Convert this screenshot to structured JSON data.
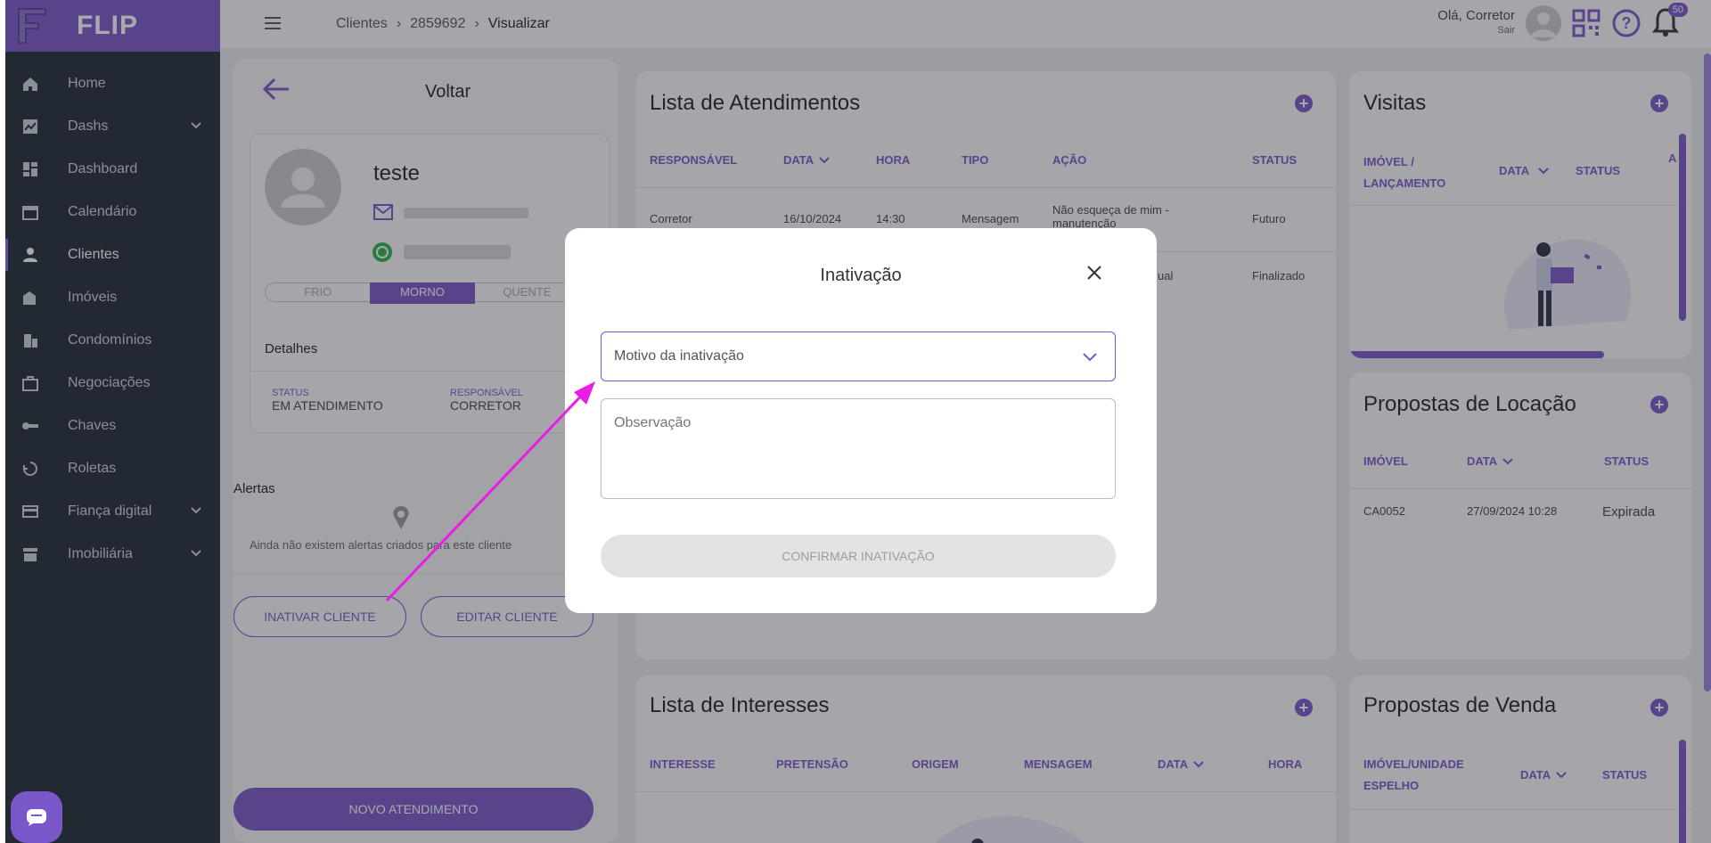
{
  "brand": {
    "name": "FLIP"
  },
  "sidebar": {
    "items": [
      {
        "label": "Home",
        "icon": "home-icon"
      },
      {
        "label": "Dashs",
        "icon": "chart-icon",
        "expandable": true
      },
      {
        "label": "Dashboard",
        "icon": "dashboard-icon"
      },
      {
        "label": "Calendário",
        "icon": "calendar-icon"
      },
      {
        "label": "Clientes",
        "icon": "person-icon",
        "active": true
      },
      {
        "label": "Imóveis",
        "icon": "building-icon"
      },
      {
        "label": "Condomínios",
        "icon": "condo-icon"
      },
      {
        "label": "Negociações",
        "icon": "briefcase-icon"
      },
      {
        "label": "Chaves",
        "icon": "key-icon"
      },
      {
        "label": "Roletas",
        "icon": "roulette-icon"
      },
      {
        "label": "Fiança digital",
        "icon": "card-icon",
        "expandable": true
      },
      {
        "label": "Imobiliária",
        "icon": "store-icon",
        "expandable": true
      }
    ]
  },
  "topbar": {
    "breadcrumb": [
      "Clientes",
      "2859692",
      "Visualizar"
    ],
    "greeting": "Olá, Corretor",
    "logout": "Sair",
    "notifications": "50"
  },
  "client": {
    "back": "Voltar",
    "name": "teste",
    "temps": [
      "FRIO",
      "MORNO",
      "QUENTE"
    ],
    "details_title": "Detalhes",
    "status_label": "STATUS",
    "status_value": "EM ATENDIMENTO",
    "resp_label": "RESPONSÁVEL",
    "resp_value": "CORRETOR",
    "alerts_title": "Alertas",
    "alerts_empty": "Ainda não existem alertas criados para este cliente",
    "inactivate": "INATIVAR CLIENTE",
    "edit": "EDITAR CLIENTE",
    "new_service": "NOVO ATENDIMENTO"
  },
  "atendimentos": {
    "title": "Lista de Atendimentos",
    "headers": [
      "RESPONSÁVEL",
      "DATA",
      "HORA",
      "TIPO",
      "AÇÃO",
      "STATUS"
    ],
    "rows": [
      [
        "Corretor",
        "16/10/2024",
        "14:30",
        "Mensagem",
        "Não esqueça de mim - manutenção",
        "Futuro"
      ],
      [
        "",
        "",
        "",
        "",
        "ual",
        "Finalizado"
      ]
    ]
  },
  "visitas": {
    "title": "Visitas",
    "headers": [
      "IMÓVEL / LANÇAMENTO",
      "DATA",
      "STATUS",
      "A"
    ]
  },
  "locacao": {
    "title": "Propostas de Locação",
    "headers": [
      "IMÓVEL",
      "DATA",
      "STATUS"
    ],
    "rows": [
      [
        "CA0052",
        "27/09/2024 10:28",
        "Expirada"
      ]
    ]
  },
  "interesses": {
    "title": "Lista de Interesses",
    "headers": [
      "INTERESSE",
      "PRETENSÃO",
      "ORIGEM",
      "MENSAGEM",
      "DATA",
      "HORA"
    ]
  },
  "venda": {
    "title": "Propostas de Venda",
    "headers": [
      "IMÓVEL/UNIDADE ESPELHO",
      "DATA",
      "STATUS"
    ]
  },
  "modal": {
    "title": "Inativação",
    "select_placeholder": "Motivo da inativação",
    "obs_placeholder": "Observação",
    "confirm": "CONFIRMAR INATIVAÇÃO"
  },
  "colors": {
    "accent": "#7a57c9",
    "sidebar": "#1f2a35",
    "annotation": "#e81ee6"
  }
}
